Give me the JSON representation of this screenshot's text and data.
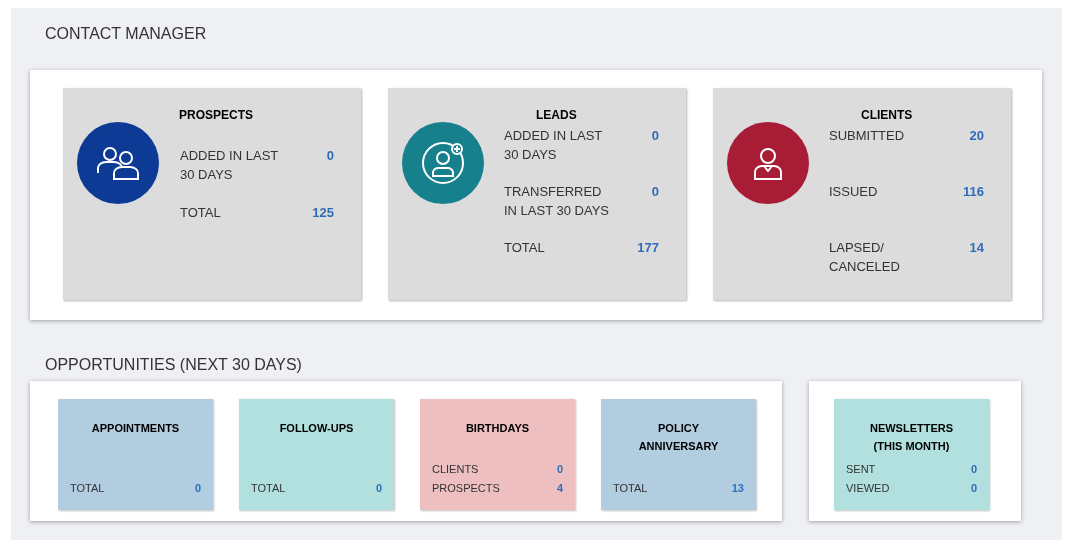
{
  "contact_manager": {
    "title": "CONTACT MANAGER",
    "cards": [
      {
        "title": "PROSPECTS",
        "kind": "group",
        "color": "#0d3a94",
        "stats": [
          {
            "label": "ADDED IN LAST 30 DAYS",
            "value": "0"
          },
          {
            "label": "TOTAL",
            "value": "125"
          }
        ]
      },
      {
        "title": "LEADS",
        "kind": "add-person",
        "color": "#17808d",
        "stats": [
          {
            "label": "ADDED IN LAST 30 DAYS",
            "value": "0"
          },
          {
            "label": "TRANSFERRED IN LAST 30 DAYS",
            "value": "0"
          },
          {
            "label": "TOTAL",
            "value": "177"
          }
        ]
      },
      {
        "title": "CLIENTS",
        "kind": "person",
        "color": "#a91c36",
        "stats": [
          {
            "label": "SUBMITTED",
            "value": "20"
          },
          {
            "label": "ISSUED",
            "value": "116"
          },
          {
            "label": "LAPSED/ CANCELED",
            "value": "14"
          }
        ]
      }
    ]
  },
  "opportunities": {
    "title": "OPPORTUNITIES (NEXT 30 DAYS)",
    "panels": [
      {
        "cards": [
          {
            "title": "APPOINTMENTS",
            "color": "#b2cde0",
            "stats": [
              {
                "label": "TOTAL",
                "value": "0"
              }
            ]
          },
          {
            "title": "FOLLOW-UPS",
            "color": "#b1e0df",
            "stats": [
              {
                "label": "TOTAL",
                "value": "0"
              }
            ]
          },
          {
            "title": "BIRTHDAYS",
            "color": "#eebfc1",
            "stats": [
              {
                "label": "CLIENTS",
                "value": "0"
              },
              {
                "label": "PROSPECTS",
                "value": "4"
              }
            ]
          },
          {
            "title": "POLICY ANNIVERSARY",
            "color": "#b2cde0",
            "stats": [
              {
                "label": "TOTAL",
                "value": "13"
              }
            ]
          }
        ]
      },
      {
        "cards": [
          {
            "title": "NEWSLETTERS (THIS MONTH)",
            "color": "#b1e0df",
            "stats": [
              {
                "label": "SENT",
                "value": "0"
              },
              {
                "label": "VIEWED",
                "value": "0"
              }
            ]
          }
        ]
      }
    ]
  }
}
